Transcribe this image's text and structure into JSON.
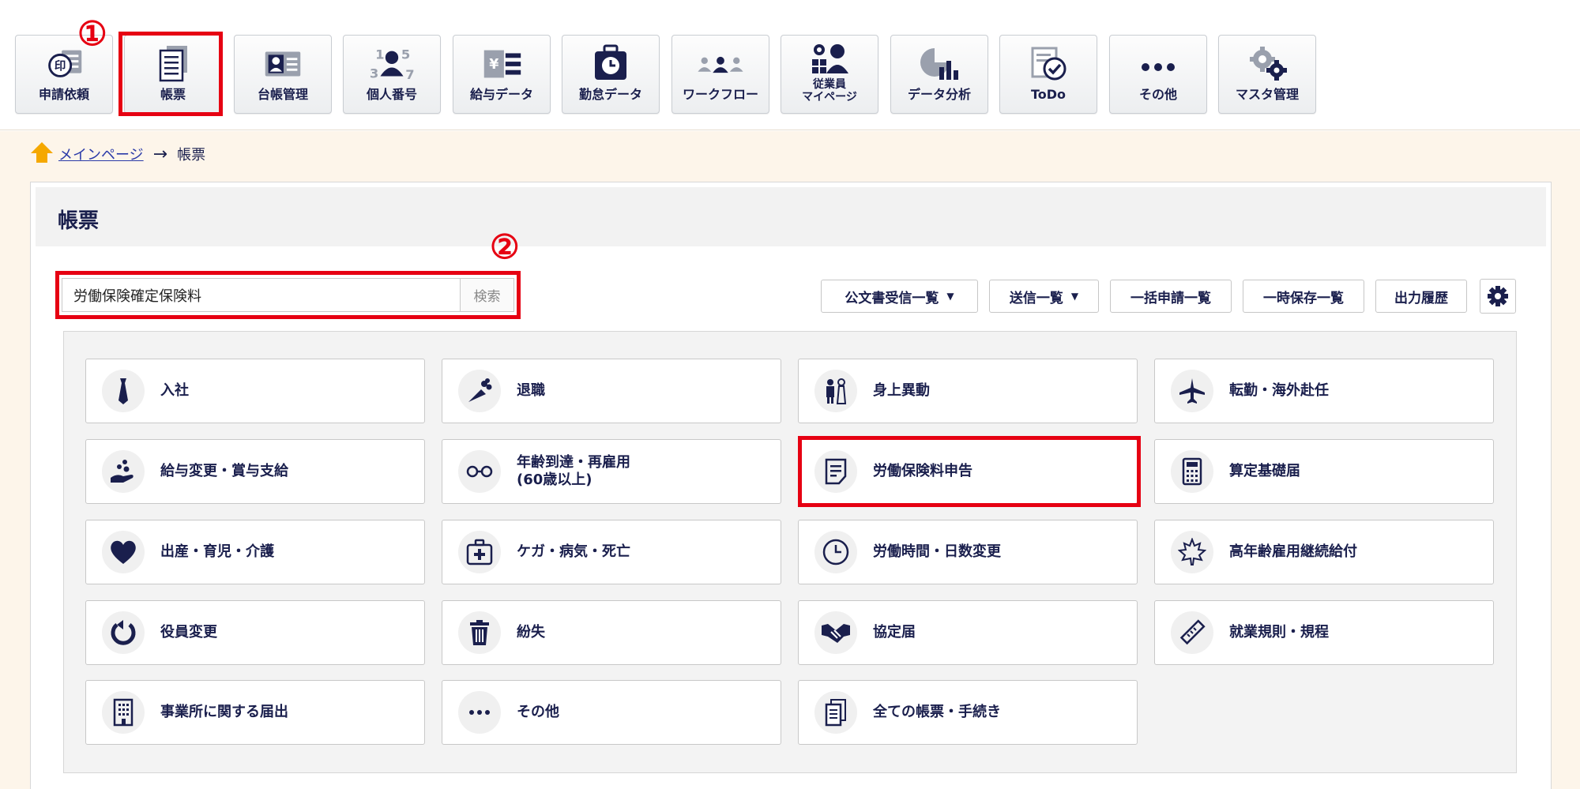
{
  "toolbar": {
    "items": [
      {
        "label": "申請依頼",
        "icon": "stamp-icon"
      },
      {
        "label": "帳票",
        "icon": "document-icon"
      },
      {
        "label": "台帳管理",
        "icon": "ledger-icon"
      },
      {
        "label": "個人番号",
        "icon": "personal-number-icon",
        "digits": [
          "1",
          "5",
          "3",
          "7"
        ]
      },
      {
        "label": "給与データ",
        "icon": "salary-data-icon",
        "symbol": "¥"
      },
      {
        "label": "勤怠データ",
        "icon": "clock-bag-icon"
      },
      {
        "label": "ワークフロー",
        "icon": "workflow-icon"
      },
      {
        "label": "従業員\nマイページ",
        "icon": "employee-page-icon"
      },
      {
        "label": "データ分析",
        "icon": "pie-chart-icon"
      },
      {
        "label": "ToDo",
        "icon": "todo-check-icon"
      },
      {
        "label": "その他",
        "icon": "more-dots-icon"
      },
      {
        "label": "マスタ管理",
        "icon": "gears-icon"
      }
    ],
    "stamp_char": "印"
  },
  "annotations": {
    "one": "①",
    "two": "②"
  },
  "breadcrumb": {
    "home": "メインページ",
    "arrow": "→",
    "current": "帳票"
  },
  "panel": {
    "title": "帳票"
  },
  "search": {
    "value": "労働保険確定保険料",
    "button": "検索"
  },
  "actions": [
    {
      "label": "公文書受信一覧",
      "dropdown": true
    },
    {
      "label": "送信一覧",
      "dropdown": true
    },
    {
      "label": "一括申請一覧",
      "dropdown": false
    },
    {
      "label": "一時保存一覧",
      "dropdown": false
    },
    {
      "label": "出力履歴",
      "dropdown": false
    }
  ],
  "categories": [
    {
      "label": "入社",
      "icon": "necktie-icon"
    },
    {
      "label": "退職",
      "icon": "bouquet-icon"
    },
    {
      "label": "身上異動",
      "icon": "wedding-couple-icon"
    },
    {
      "label": "転勤・海外赴任",
      "icon": "airplane-icon"
    },
    {
      "label": "給与変更・賞与支給",
      "icon": "hand-coins-icon"
    },
    {
      "label": "年齢到達・再雇用\n(60歳以上)",
      "icon": "glasses-icon"
    },
    {
      "label": "労働保険料申告",
      "icon": "form-document-icon"
    },
    {
      "label": "算定基礎届",
      "icon": "calculator-icon"
    },
    {
      "label": "出産・育児・介護",
      "icon": "heart-icon"
    },
    {
      "label": "ケガ・病気・死亡",
      "icon": "first-aid-kit-icon"
    },
    {
      "label": "労働時間・日数変更",
      "icon": "clock-icon"
    },
    {
      "label": "高年齢雇用継続給付",
      "icon": "maple-leaf-icon"
    },
    {
      "label": "役員変更",
      "icon": "refresh-icon"
    },
    {
      "label": "紛失",
      "icon": "trash-icon"
    },
    {
      "label": "協定届",
      "icon": "handshake-icon"
    },
    {
      "label": "就業規則・規程",
      "icon": "ruler-icon"
    },
    {
      "label": "事業所に関する届出",
      "icon": "building-icon"
    },
    {
      "label": "その他",
      "icon": "ellipsis-icon"
    },
    {
      "label": "全ての帳票・手続き",
      "icon": "documents-icon"
    }
  ],
  "colors": {
    "navy": "#1a1f4d",
    "highlight": "#e60012",
    "background": "#fdf5ea"
  }
}
